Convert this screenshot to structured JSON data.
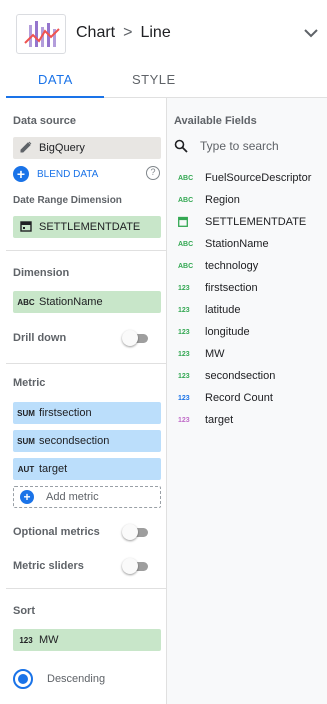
{
  "header": {
    "title": "Chart",
    "separator": ">",
    "subtitle": "Line",
    "chart_icon": "line-chart-thumbnail-icon"
  },
  "tabs": [
    {
      "label": "DATA",
      "active": true
    },
    {
      "label": "STYLE",
      "active": false
    }
  ],
  "data_source": {
    "label": "Data source",
    "value": "BigQuery",
    "icon": "pencil-icon",
    "blend_label": "BLEND DATA",
    "help_icon": "help-icon"
  },
  "date_range": {
    "label": "Date Range Dimension",
    "value": "SETTLEMENTDATE",
    "icon": "calendar-icon"
  },
  "dimension": {
    "label": "Dimension",
    "items": [
      {
        "type": "ABC",
        "label": "StationName"
      }
    ],
    "drill_down_label": "Drill down",
    "drill_down_on": false
  },
  "metric": {
    "label": "Metric",
    "items": [
      {
        "type": "SUM",
        "label": "firstsection"
      },
      {
        "type": "SUM",
        "label": "secondsection"
      },
      {
        "type": "AUT",
        "label": "target"
      }
    ],
    "add_label": "Add metric",
    "optional_metrics_label": "Optional metrics",
    "optional_metrics_on": false,
    "metric_sliders_label": "Metric sliders",
    "metric_sliders_on": false
  },
  "sort": {
    "label": "Sort",
    "field": {
      "type": "123",
      "label": "MW"
    },
    "order_label": "Descending",
    "descending_selected": true
  },
  "available_fields": {
    "title": "Available Fields",
    "search_placeholder": "Type to search",
    "items": [
      {
        "type": "ABC",
        "label": "FuelSourceDescriptor",
        "color": "#34a853"
      },
      {
        "type": "ABC",
        "label": "Region",
        "color": "#34a853"
      },
      {
        "type": "calendar",
        "label": "SETTLEMENTDATE",
        "color": "#34a853"
      },
      {
        "type": "ABC",
        "label": "StationName",
        "color": "#34a853"
      },
      {
        "type": "ABC",
        "label": "technology",
        "color": "#34a853"
      },
      {
        "type": "123",
        "label": "firstsection",
        "color": "#34a853"
      },
      {
        "type": "123",
        "label": "latitude",
        "color": "#34a853"
      },
      {
        "type": "123",
        "label": "longitude",
        "color": "#34a853"
      },
      {
        "type": "123",
        "label": "MW",
        "color": "#34a853"
      },
      {
        "type": "123",
        "label": "secondsection",
        "color": "#34a853"
      },
      {
        "type": "123",
        "label": "Record Count",
        "color": "#1a73e8"
      },
      {
        "type": "123",
        "label": "target",
        "color": "#c06cc8"
      }
    ]
  },
  "colors": {
    "accent": "#1a73e8",
    "dimension_chip": "#c8e6c9",
    "metric_chip": "#bbdefb",
    "source_chip": "#e8e6e3"
  }
}
